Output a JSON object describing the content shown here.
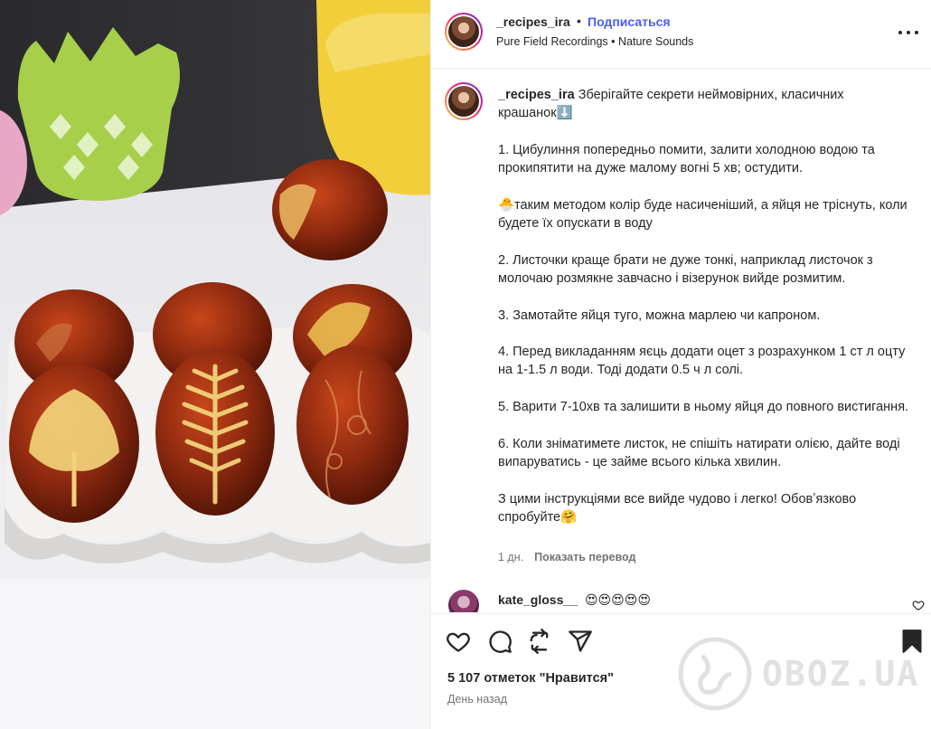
{
  "header": {
    "username": "_recipes_ira",
    "separator": "•",
    "follow_label": "Подписаться",
    "audio": "Pure Field Recordings • Nature Sounds"
  },
  "caption": {
    "username": "_recipes_ira",
    "text": "Зберігайте секрети неймовірних, класичних крашанок⬇️\n\n1. Цибулиння попередньо помити, залити холодною водою та прокипятити на дуже малому вогні 5 хв; остудити.\n\n🐣таким методом колір буде насиченіший, а яйця не тріснуть, коли будете їх опускати в воду\n\n2. Листочки краще брати не дуже тонкі, наприклад листочок з молочаю розмякне завчасно і візерунок вийде розмитим.\n\n3. Замотайте яйця туго, можна марлею чи капроном.\n\n4. Перед викладанням яєць додати оцет з розрахунком 1 ст л оцту на 1-1.5 л води. Тоді додати 0.5 ч л солі.\n\n5. Варити 7-10хв та залишити в ньому яйця до повного вистигання.\n\n6. Коли зніматимете листок, не спішіть натирати олією, дайте воді випаруватись - це займе всього кілька хвилин.\n\nЗ цими інструкціями все вийде чудово і легко! Обовʼязково спробуйте🤗",
    "time": "1 дн.",
    "translate_label": "Показать перевод"
  },
  "comment": {
    "username": "kate_gloss__",
    "text": "😍😍😍😍😍"
  },
  "footer": {
    "likes": "5 107 отметок \"Нравится\"",
    "date": "День назад"
  },
  "watermark": {
    "text": "OBOZ.UA"
  },
  "icons": {
    "like": "heart-icon",
    "comment": "comment-icon",
    "repost": "repost-icon",
    "share": "send-icon",
    "save": "bookmark-icon",
    "more": "more-icon",
    "comment_like": "heart-icon"
  },
  "colors": {
    "follow": "#4a5df9",
    "muted": "#737373",
    "text": "#262626"
  }
}
